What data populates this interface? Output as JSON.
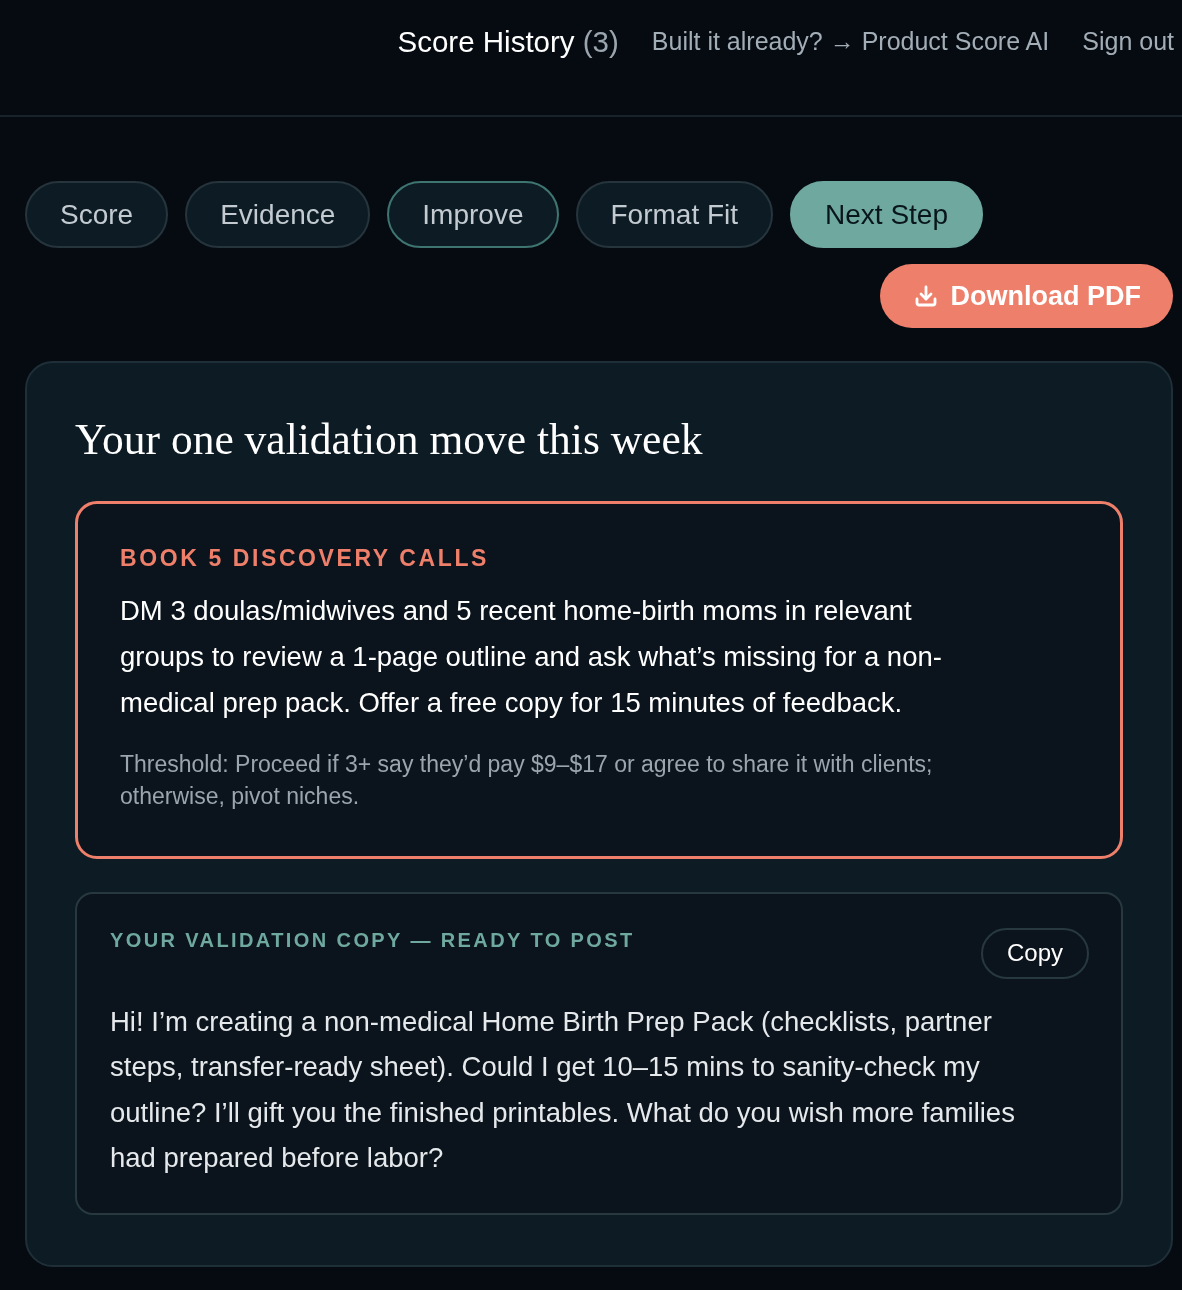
{
  "header": {
    "history": {
      "label": "Score History",
      "count": "(3)"
    },
    "links": [
      {
        "label": "Built it already? → Product Score AI"
      },
      {
        "label": "Sign out"
      }
    ]
  },
  "tabs": [
    {
      "label": "Score",
      "selected": false,
      "focused": false
    },
    {
      "label": "Evidence",
      "selected": false,
      "focused": false
    },
    {
      "label": "Improve",
      "selected": false,
      "focused": true
    },
    {
      "label": "Format Fit",
      "selected": false,
      "focused": false
    },
    {
      "label": "Next Step",
      "selected": true,
      "focused": false
    }
  ],
  "download_button": {
    "label": "Download PDF"
  },
  "card": {
    "title": "Your one validation move this week",
    "action": {
      "label": "BOOK 5 DISCOVERY CALLS",
      "body": "DM 3 doulas/midwives and 5 recent home-birth moms in relevant groups to review a 1-page outline and ask what’s missing for a non-medical prep pack. Offer a free copy for 15 minutes of feedback.",
      "threshold": "Threshold: Proceed if 3+ say they’d pay $9–$17 or agree to share it with clients; otherwise, pivot niches."
    },
    "copy_block": {
      "label": "YOUR VALIDATION COPY — READY TO POST",
      "button": "Copy",
      "text": "Hi! I’m creating a non-medical Home Birth Prep Pack (checklists, partner steps, transfer-ready sheet). Could I get 10–15 mins to sanity-check my outline? I’ll gift you the finished printables. What do you wish more families had prepared before labor?"
    }
  }
}
